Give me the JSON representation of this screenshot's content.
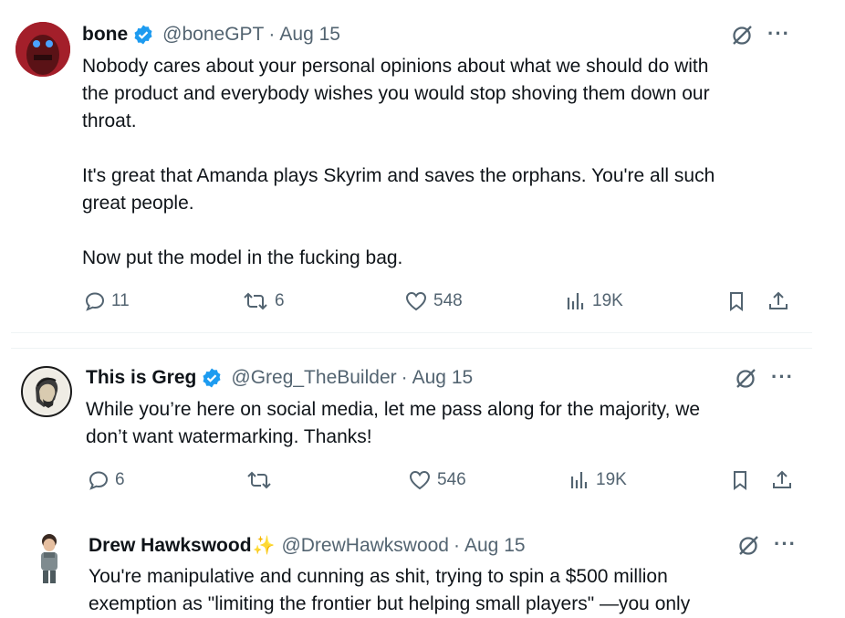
{
  "tweets": [
    {
      "name": "bone",
      "handle": "@boneGPT",
      "dot": "·",
      "date": "Aug 15",
      "text": "Nobody cares about your personal opinions about what we should do with\nthe product and everybody wishes you would stop shoving them down our\nthroat.\n\nIt's great that Amanda plays Skyrim and saves the orphans. You're all such\ngreat people.\n\nNow put the model in the fucking bag.",
      "replies": "11",
      "reposts": "6",
      "likes": "548",
      "views": "19K"
    },
    {
      "name": "This is Greg",
      "handle": "@Greg_TheBuilder",
      "dot": "·",
      "date": "Aug 15",
      "text": "While you’re here on social media, let me pass along for the majority, we\ndon’t want watermarking. Thanks!",
      "replies": "6",
      "reposts": "",
      "likes": "546",
      "views": "19K"
    },
    {
      "name": "Drew Hawkswood",
      "handle": "@DrewHawkswood",
      "dot": "·",
      "date": "Aug 15",
      "text": "You're manipulative and cunning as shit, trying to spin a $500 million\nexemption as \"limiting the frontier but helping small players\" —you only"
    }
  ],
  "icons": {
    "more": "···",
    "sparkle": "✨",
    "verified_color": "#1d9bf0"
  }
}
